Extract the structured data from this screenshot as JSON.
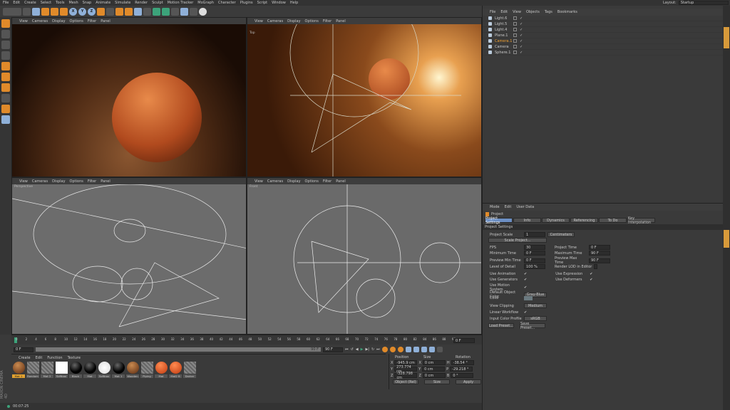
{
  "menu": [
    "File",
    "Edit",
    "Create",
    "Select",
    "Tools",
    "Mesh",
    "Snap",
    "Animate",
    "Simulate",
    "Render",
    "Sculpt",
    "Motion Tracker",
    "MoGraph",
    "Character",
    "Plugins",
    "Script",
    "Window",
    "Help"
  ],
  "layout": {
    "label": "Layout:",
    "value": "Startup"
  },
  "toolbar": {
    "axes": [
      "X",
      "Y",
      "Z"
    ]
  },
  "viewport_menu": [
    "View",
    "Cameras",
    "Display",
    "Options",
    "Filter",
    "Panel"
  ],
  "viewports": [
    {
      "label": ""
    },
    {
      "label": "Top"
    },
    {
      "label": "Perspective"
    },
    {
      "label": "Front"
    }
  ],
  "object_manager": {
    "menu": [
      "File",
      "Edit",
      "View",
      "Objects",
      "Tags",
      "Bookmarks"
    ],
    "objects": [
      {
        "name": "Light.6"
      },
      {
        "name": "Light.5"
      },
      {
        "name": "Light.4"
      },
      {
        "name": "Plane.1"
      },
      {
        "name": "Camera.1",
        "active": true
      },
      {
        "name": "Camera"
      },
      {
        "name": "Sphere.1"
      }
    ]
  },
  "attributes": {
    "menu": [
      "Mode",
      "Edit",
      "User Data"
    ],
    "title": "Project",
    "tabs": [
      "Project Settings",
      "Info",
      "Dynamics",
      "Referencing",
      "To Do",
      "Key Interpolation"
    ],
    "section": "Project Settings",
    "project_scale": {
      "label": "Project Scale",
      "value": "1",
      "unit": "Centimeters"
    },
    "scale_button": "Scale Project...",
    "fps": {
      "label": "FPS",
      "value": "30"
    },
    "project_time": {
      "label": "Project Time",
      "value": "0 F"
    },
    "min_time": {
      "label": "Minimum Time",
      "value": "0 F"
    },
    "max_time": {
      "label": "Maximum Time",
      "value": "90 F"
    },
    "prev_min": {
      "label": "Preview Min Time",
      "value": "0 F"
    },
    "prev_max": {
      "label": "Preview Max Time",
      "value": "90 F"
    },
    "lod": {
      "label": "Level of Detail",
      "value": "100 %"
    },
    "render_lod": "Render LOD in Editor",
    "use_animation": "Use Animation",
    "use_expression": "Use Expression",
    "use_generators": "Use Generators",
    "use_deformers": "Use Deformers",
    "use_motion": "Use Motion System",
    "default_color": {
      "label": "Default Object Color",
      "value": "Gray-Blue"
    },
    "color": "Color",
    "view_clipping": {
      "label": "View Clipping",
      "value": "Medium"
    },
    "linear": "Linear Workflow",
    "color_profile": {
      "label": "Input Color Profile",
      "value": "sRGB"
    },
    "load_preset": "Load Preset...",
    "save_preset": "Save Preset..."
  },
  "timeline": {
    "ticks": [
      0,
      2,
      4,
      6,
      8,
      10,
      12,
      14,
      16,
      18,
      20,
      22,
      24,
      26,
      28,
      30,
      32,
      34,
      36,
      38,
      40,
      42,
      44,
      46,
      48,
      50,
      52,
      54,
      56,
      58,
      60,
      62,
      64,
      66,
      68,
      70,
      72,
      74,
      76,
      78,
      80,
      82,
      84,
      86,
      88,
      90
    ],
    "current": "0 F",
    "start": "0 F",
    "end": "90 F",
    "end2": "90 F"
  },
  "materials": {
    "menu": [
      "Create",
      "Edit",
      "Function",
      "Texture"
    ],
    "items": [
      {
        "name": "Mat 1",
        "kind": "wood"
      },
      {
        "name": "Random",
        "kind": "hatch"
      },
      {
        "name": "Mat 2",
        "kind": "hatch"
      },
      {
        "name": "Softbox",
        "kind": "white"
      },
      {
        "name": "Black",
        "kind": "black"
      },
      {
        "name": "Mat",
        "kind": "black"
      },
      {
        "name": "Softbox",
        "kind": "whiteball"
      },
      {
        "name": "Mat 1",
        "kind": "black"
      },
      {
        "name": "Wooden",
        "kind": "wood"
      },
      {
        "name": "Piping",
        "kind": "hatch"
      },
      {
        "name": "Mat",
        "kind": "orange"
      },
      {
        "name": "Mat2 B",
        "kind": "orange"
      },
      {
        "name": "Darker",
        "kind": "hatch"
      }
    ]
  },
  "coords": {
    "headers": [
      "Position",
      "Size",
      "Rotation"
    ],
    "rows": [
      {
        "axis": "X",
        "pos": "-945.9 cm",
        "saxis": "X",
        "size": "0 cm",
        "raxis": "H",
        "rot": "-38.54 °"
      },
      {
        "axis": "Y",
        "pos": "273.774 cm",
        "saxis": "Y",
        "size": "0 cm",
        "raxis": "P",
        "rot": "-29.218 °"
      },
      {
        "axis": "Z",
        "pos": "-328.798 cm",
        "saxis": "Z",
        "size": "0 cm",
        "raxis": "B",
        "rot": "0 °"
      }
    ],
    "mode": "Object (Rel)",
    "size_mode": "Size",
    "apply": "Apply"
  },
  "status": {
    "time": "00:07:25"
  },
  "brand": "MAXON CINEMA 4D"
}
